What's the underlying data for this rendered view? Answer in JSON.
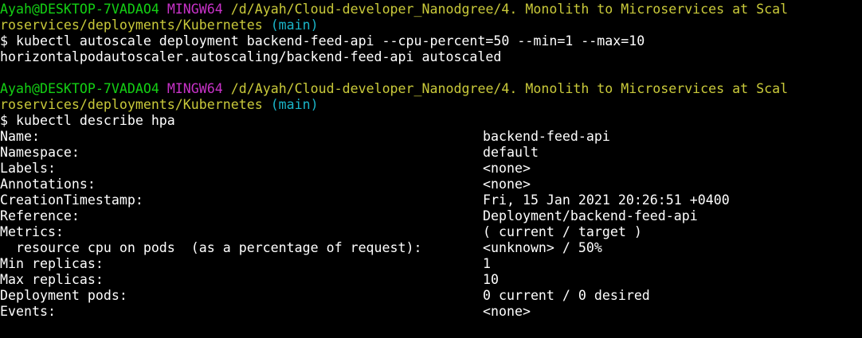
{
  "colors": {
    "background": "#000000",
    "text": "#ffffff",
    "user_host": "#14d014",
    "shell": "#c832c8",
    "path": "#c9c93a",
    "branch": "#1ab5c9"
  },
  "blocks": [
    {
      "prompt": {
        "user_host": "Ayah@DESKTOP-7VADAO4",
        "shell": "MINGW64",
        "path_line1": "/d/Ayah/Cloud-developer_Nanodgree/4. Monolith to Microservices at Scal",
        "path_line2": "roservices/deployments/Kubernetes",
        "branch": "(main)"
      },
      "command": "$ kubectl autoscale deployment backend-feed-api --cpu-percent=50 --min=1 --max=10",
      "output": "horizontalpodautoscaler.autoscaling/backend-feed-api autoscaled"
    },
    {
      "prompt": {
        "user_host": "Ayah@DESKTOP-7VADAO4",
        "shell": "MINGW64",
        "path_line1": "/d/Ayah/Cloud-developer_Nanodgree/4. Monolith to Microservices at Scal",
        "path_line2": "roservices/deployments/Kubernetes",
        "branch": "(main)"
      },
      "command": "$ kubectl describe hpa"
    }
  ],
  "hpa_rows": [
    {
      "key": "Name:",
      "value": "backend-feed-api"
    },
    {
      "key": "Namespace:",
      "value": "default"
    },
    {
      "key": "Labels:",
      "value": "<none>"
    },
    {
      "key": "Annotations:",
      "value": "<none>"
    },
    {
      "key": "CreationTimestamp:",
      "value": "Fri, 15 Jan 2021 20:26:51 +0400"
    },
    {
      "key": "Reference:",
      "value": "Deployment/backend-feed-api"
    },
    {
      "key": "Metrics:",
      "value": "( current / target )"
    },
    {
      "key": "  resource cpu on pods  (as a percentage of request):",
      "value": "<unknown> / 50%"
    },
    {
      "key": "Min replicas:",
      "value": "1"
    },
    {
      "key": "Max replicas:",
      "value": "10"
    },
    {
      "key": "Deployment pods:",
      "value": "0 current / 0 desired"
    },
    {
      "key": "Events:",
      "value": "<none>"
    }
  ]
}
